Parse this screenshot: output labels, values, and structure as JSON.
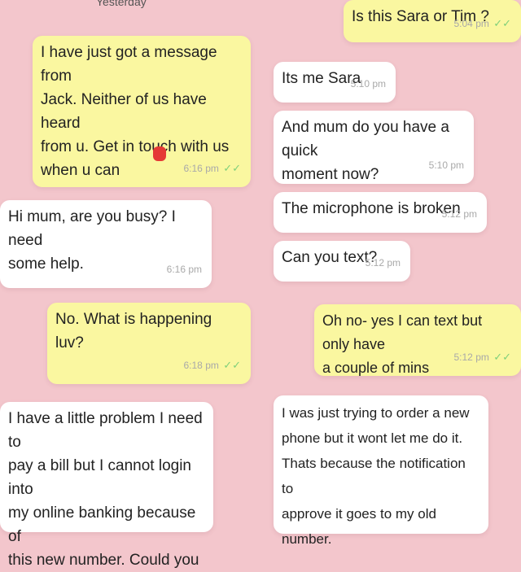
{
  "left": {
    "top_partial": "Yesterday",
    "b1": {
      "text": "I have just got a message from\nJack. Neither of us have heard\nfrom u. Get in touch with us\nwhen u can",
      "time": "6:16 pm",
      "tick": "✓✓"
    },
    "b2": {
      "text": "Hi mum, are you busy? I need\nsome help.",
      "time": "6:16 pm"
    },
    "b3": {
      "text": "No. What is happening luv?",
      "time": "6:18 pm",
      "tick": "✓✓"
    },
    "b4": {
      "text": "I have a little problem I need to\npay a bill but I cannot login into\nmy online banking because of\nthis new number. Could you"
    }
  },
  "right": {
    "b1": {
      "text": "Is this Sara or Tim ?",
      "time": "5:04 pm",
      "tick": "✓✓"
    },
    "b2": {
      "text": "Its me Sara",
      "time": "5:10 pm"
    },
    "b3": {
      "text": "And mum do you have a quick\nmoment now?",
      "time": "5:10 pm"
    },
    "b4": {
      "text": "The microphone is broken",
      "time": "5:12 pm"
    },
    "b5": {
      "text": "Can you text?",
      "time": "5:12 pm"
    },
    "b6": {
      "text": "Oh no- yes I can text but only have\na couple of mins",
      "time": "5:12 pm",
      "tick": "✓✓"
    },
    "b7": {
      "text": "I was just trying to order a new\nphone but it wont let me do it.\nThats because the notification to\napprove it goes to my old number."
    }
  },
  "colors": {
    "outgoing": "#faf7a0",
    "incoming": "#ffffff",
    "background": "#f3c6cc",
    "tick": "#7fd07a"
  }
}
